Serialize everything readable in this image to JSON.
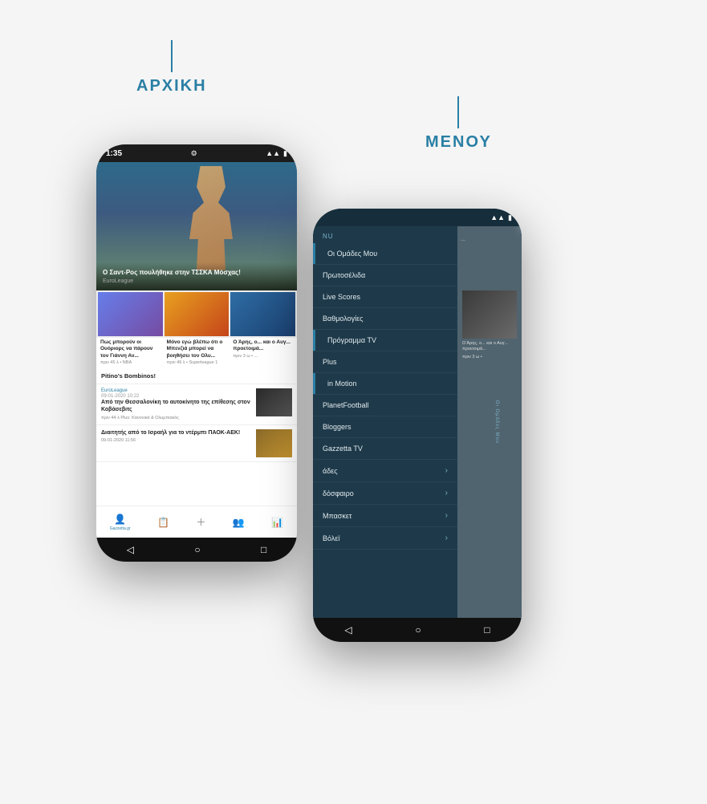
{
  "labels": {
    "arxiki": "ΑΡΧΙΚΗ",
    "menou": "ΜΕΝΟΥ"
  },
  "phone_home": {
    "status_time": "1:35",
    "hero_title": "Ο Σαντ-Ρος πουλήθηκε στην ΤΣΣΚΑ Μόσχας!",
    "hero_category": "EuroLeague",
    "news_items": [
      {
        "title": "Πως μπορούν οι Ουόριορς να πάρουν τον Γιάννη Αν...",
        "meta": "πριν 45 λ • NBA"
      },
      {
        "title": "Μόνο εγώ βλέπω ότι ο Μπενζιά μπορεί να βοηθήσει τον Ολυ...",
        "meta": "πριν 49 λ • Superleague 1"
      },
      {
        "title": "Ο Άρης, ο... και ο Αυγ... προετοιμά...",
        "meta": "πριν 3 ω • ..."
      }
    ],
    "pitino_title": "Pitino's Bombinos!",
    "article1_cat": "EuroLeague",
    "article1_date": "09-01-2020 10:22",
    "article1_title": "Από την Θεσσαλονίκη το αυτοκίνητο της επίθεσης στον Κοβάσεβιτς",
    "article1_meta": "πριν 44 λ",
    "article1_sub": "Plus: Κανονικά & Ολυμπιακός",
    "article2_title": "Διαιτητής από το Ισραήλ για το ντέρμπι ΠΑΟΚ-ΑΕΚ!",
    "article2_date": "09-01-2020 11:56",
    "nav_items": [
      "Gazzetta.gr",
      "",
      "",
      "",
      ""
    ],
    "nav_icons": [
      "👤",
      "📋",
      "+",
      "👥",
      "📊"
    ]
  },
  "phone_menu": {
    "menu_title": "nu",
    "menu_items": [
      {
        "label": "Οι Ομάδες Μου",
        "has_arrow": false
      },
      {
        "label": "Πρωτοσέλιδα",
        "has_arrow": false
      },
      {
        "label": "Live Scores",
        "has_arrow": false
      },
      {
        "label": "Βαθμολογίες",
        "has_arrow": false
      },
      {
        "label": "Πρόγραμμα TV",
        "has_arrow": false
      },
      {
        "label": "Plus",
        "has_arrow": false
      },
      {
        "label": "in Motion",
        "has_arrow": false
      },
      {
        "label": "PlanetFootball",
        "has_arrow": false
      },
      {
        "label": "Bloggers",
        "has_arrow": false
      },
      {
        "label": "Gazzetta TV",
        "has_arrow": false
      },
      {
        "label": "άδες",
        "has_arrow": true
      },
      {
        "label": "δόσφαιρο",
        "has_arrow": true
      },
      {
        "label": "Μπασκετ",
        "has_arrow": true
      },
      {
        "label": "Βόλεϊ",
        "has_arrow": true
      }
    ],
    "right_panel_caption": "Ο Άρης, ο... και ο Αυγ... προετοιμά...",
    "right_panel_meta": "πριν 3 ω •",
    "vertical_text": "Οι Ομάδες Μου"
  }
}
